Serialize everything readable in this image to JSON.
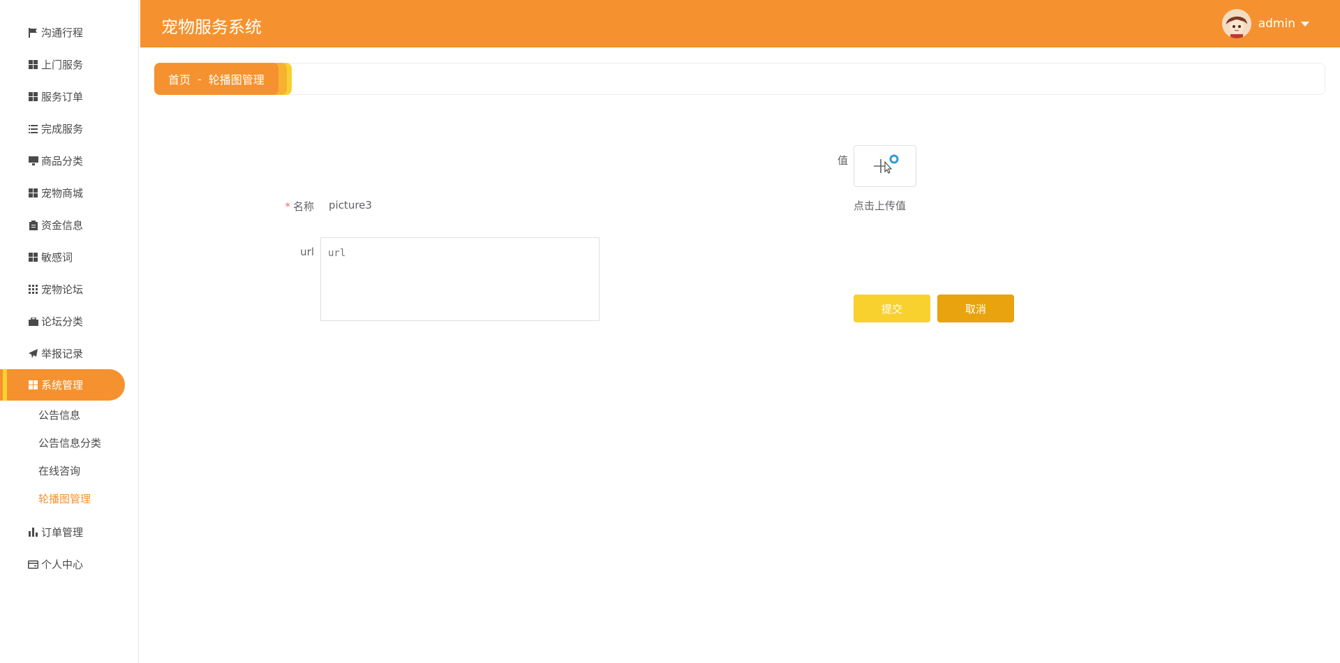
{
  "app": {
    "title": "宠物服务系统"
  },
  "user": {
    "name": "admin"
  },
  "sidebar": {
    "items": [
      {
        "label": "沟通行程",
        "icon": "flag-icon"
      },
      {
        "label": "上门服务",
        "icon": "grid-icon"
      },
      {
        "label": "服务订单",
        "icon": "grid-icon"
      },
      {
        "label": "完成服务",
        "icon": "list-icon"
      },
      {
        "label": "商品分类",
        "icon": "monitor-icon"
      },
      {
        "label": "宠物商城",
        "icon": "grid-icon"
      },
      {
        "label": "资金信息",
        "icon": "clipboard-icon"
      },
      {
        "label": "敏感词",
        "icon": "grid-icon"
      },
      {
        "label": "宠物论坛",
        "icon": "apps-icon"
      },
      {
        "label": "论坛分类",
        "icon": "briefcase-icon"
      },
      {
        "label": "举报记录",
        "icon": "send-icon"
      },
      {
        "label": "系统管理",
        "icon": "grid-icon"
      },
      {
        "label": "订单管理",
        "icon": "bar-chart-icon"
      },
      {
        "label": "个人中心",
        "icon": "card-icon"
      }
    ],
    "submenu": [
      {
        "label": "公告信息"
      },
      {
        "label": "公告信息分类"
      },
      {
        "label": "在线咨询"
      },
      {
        "label": "轮播图管理"
      }
    ]
  },
  "breadcrumb": {
    "home": "首页",
    "separator": "-",
    "current": "轮播图管理"
  },
  "form": {
    "name_label": "名称",
    "name_value": "picture3",
    "url_label": "url",
    "url_placeholder": "url",
    "value_label": "值",
    "upload_hint": "点击上传值",
    "submit_label": "提交",
    "cancel_label": "取消"
  },
  "colors": {
    "primary": "#f5922f",
    "accent": "#f8d12f",
    "cancel": "#e8a30e"
  }
}
